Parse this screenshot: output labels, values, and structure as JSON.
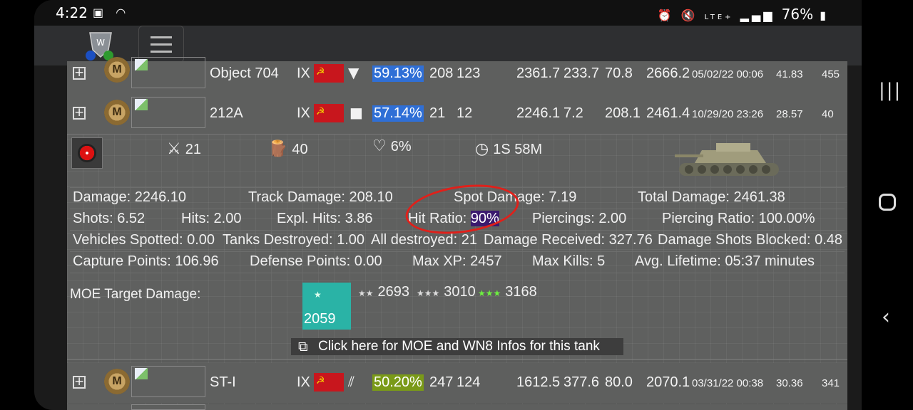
{
  "status_bar": {
    "time": "4:22",
    "battery": "76%",
    "network": "LTE+"
  },
  "tank_rows": [
    {
      "name": "Object 704",
      "tier": "IX",
      "type_icon": "▼",
      "winrate": "59.13%",
      "winrate_color": "#2f6fd6",
      "battles": "208",
      "wins": "123",
      "damage": "2361.7",
      "assist": "233.7",
      "exp_col": "70.8",
      "total": "2666.2",
      "date": "05/02/22 00:06",
      "ratio": "41.83",
      "last": "455"
    },
    {
      "name": "212A",
      "tier": "IX",
      "type_icon": "■",
      "winrate": "57.14%",
      "winrate_color": "#2f6fd6",
      "battles": "21",
      "wins": "12",
      "damage": "2246.1",
      "assist": "7.2",
      "exp_col": "208.1",
      "total": "2461.4",
      "date": "10/29/20 23:26",
      "ratio": "28.57",
      "last": "40"
    },
    {
      "name": "ST-I",
      "tier": "IX",
      "type_icon": "⫽",
      "winrate": "50.20%",
      "winrate_color": "#7a9a18",
      "battles": "247",
      "wins": "124",
      "damage": "1612.5",
      "assist": "377.6",
      "exp_col": "80.0",
      "total": "2070.1",
      "date": "03/31/22 00:38",
      "ratio": "30.36",
      "last": "341"
    }
  ],
  "detail": {
    "kills": "21",
    "trees": "40",
    "survival": "6%",
    "lifetime_total": "1S 58M",
    "stats": {
      "damage": "Damage: 2246.10",
      "track_damage": "Track Damage: 208.10",
      "spot_damage": "Spot Damage: 7.19",
      "total_damage": "Total Damage: 2461.38",
      "shots": "Shots: 6.52",
      "hits": "Hits: 2.00",
      "expl_hits": "Expl. Hits: 3.86",
      "hit_ratio_label": "Hit Ratio: ",
      "hit_ratio_value": "90%",
      "piercings": "Piercings: 2.00",
      "piercing_ratio": "Piercing Ratio: 100.00%",
      "vehicles_spotted": "Vehicles Spotted: 0.00",
      "tanks_destroyed": "Tanks Destroyed: 1.00",
      "all_destroyed": "All destroyed: 21",
      "damage_received": "Damage Received: 327.76",
      "damage_blocked": "Damage Shots Blocked: 0.48",
      "capture_points": "Capture Points: 106.96",
      "defense_points": "Defense Points: 0.00",
      "max_xp": "Max XP: 2457",
      "max_kills": "Max Kills: 5",
      "avg_lifetime": "Avg. Lifetime: 05:37 minutes"
    },
    "moe": {
      "label": "MOE Target Damage:",
      "one_star": "2059",
      "two_star": "2693",
      "three_star": "3010",
      "four_star": "3168"
    },
    "link_text": "Click here for MOE and WN8 Infos for this tank"
  },
  "colors": {
    "highlight": "#3b1a6e",
    "moe_box": "#2ab3a6",
    "annotation": "#e0201a"
  },
  "badge_letter": "M"
}
